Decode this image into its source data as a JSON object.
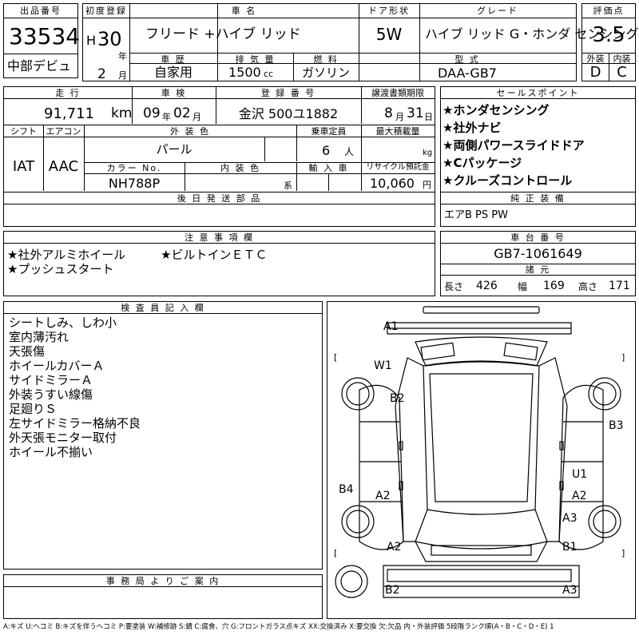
{
  "header": {
    "lot_label": "出品番号",
    "lot_number": "33534",
    "debut": "中部デビュ",
    "first_reg_label": "初度登録",
    "era": "H",
    "year": "30",
    "year_unit": "年",
    "month": "2",
    "month_unit": "月",
    "car_name_label": "車 名",
    "car_name": "フリード +ハイブ リッド",
    "door_label": "ドア形状",
    "door": "5W",
    "grade_label": "グレード",
    "grade": "ハイブ リッド G・ホンダ センシング",
    "score_label": "評価点",
    "score": "3.5",
    "history_label": "車 歴",
    "history": "自家用",
    "displacement_label": "排 気 量",
    "displacement": "1500",
    "displacement_unit": "cc",
    "fuel_label": "燃 料",
    "fuel": "ガソリン",
    "model_label": "型 式",
    "model": "DAA-GB7",
    "exterior_label": "外装",
    "exterior": "D",
    "interior_label": "内装",
    "interior": "C"
  },
  "row2": {
    "mileage_label": "走 行",
    "mileage": "91,711",
    "mileage_unit": "km",
    "inspection_label": "車 検",
    "insp_year": "09",
    "insp_year_unit": "年",
    "insp_month": "02",
    "insp_month_unit": "月",
    "reg_label": "登 録 番 号",
    "reg_number": "金沢 500ユ1882",
    "transfer_label": "譲渡書類期限",
    "transfer_month": "8",
    "transfer_month_unit": "月",
    "transfer_day": "31",
    "transfer_day_unit": "日",
    "shift_label": "シフト",
    "shift": "IAT",
    "ac_label": "エアコン",
    "ac": "AAC",
    "ext_color_label": "外 装 色",
    "ext_color": "パール",
    "capacity_label": "乗車定員",
    "capacity": "6",
    "capacity_unit": "人",
    "max_load_label": "最大積載量",
    "max_load_unit": "kg",
    "color_no_label": "カラー No.",
    "color_no": "NH788P",
    "int_color_label": "内 装 色",
    "int_color_unit": "系",
    "import_label": "輸 入 車",
    "recycle_label": "リサイクル預託金",
    "recycle": "10,060",
    "recycle_unit": "円",
    "parts_label": "後 日 発 送 部 品"
  },
  "selling_points": {
    "label": "セールスポイント",
    "items": [
      "★ホンダセンシング",
      "★社外ナビ",
      "★両側パワースライドドア",
      "★Cパッケージ",
      "★クルーズコントロール"
    ]
  },
  "genuine": {
    "label": "純 正 装 備",
    "value": "エアB PS PW"
  },
  "notes": {
    "label": "注 意 事 項 欄",
    "line1a": "★社外アルミホイール",
    "line1b": "★ビルトインＥＴＣ",
    "line2": "★プッシュスタート"
  },
  "chassis": {
    "label": "車 台 番 号",
    "value": "GB7-1061649",
    "spec_label": "諸 元",
    "length_label": "長さ",
    "length": "426",
    "width_label": "幅",
    "width": "169",
    "height_label": "高さ",
    "height": "171"
  },
  "inspector": {
    "label": "検 査 員 記 入 欄",
    "items": [
      "シートしみ、しわ小",
      "室内薄汚れ",
      "天張傷",
      "ホイールカバーＡ",
      "サイドミラーＡ",
      "外装うすい線傷",
      "足廻りＳ",
      "左サイドミラー格納不良",
      "外天張モニター取付",
      "ホイール不揃い"
    ]
  },
  "office": {
    "label": "事 務 局 よ り ご 案 内"
  },
  "diagram_marks": {
    "a1": "A1",
    "w1": "W1",
    "b2_top": "B2",
    "b3": "B3",
    "u1": "U1",
    "b4": "B4",
    "a2_left": "A2",
    "a2_right": "A2",
    "a3_right": "A3",
    "a2_bottom": "A2",
    "b1": "B1",
    "b2_bottom": "B2",
    "a3_bottom": "A3"
  },
  "legend": "A:キズ U:ヘコミ B:キズを伴うヘコミ P:要塗装 W:補修跡 S:錆 C:腐食、穴 G:フロントガラス点キズ XX:交換済み X:要交換 欠:欠品 内・外装評価 5段階ランク順(A・B・C・D・E) 1"
}
